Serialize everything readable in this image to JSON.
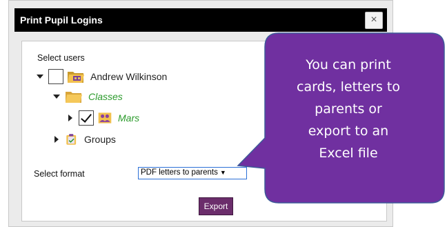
{
  "dialog": {
    "title": "Print Pupil Logins",
    "close_label": "×"
  },
  "form": {
    "select_users_label": "Select users",
    "tree": [
      {
        "label": "Andrew Wilkinson",
        "expanded": true,
        "checked": false,
        "icon": "staff-folder-icon"
      },
      {
        "label": "Classes",
        "expanded": true,
        "icon": "folder-icon",
        "color": "#2a9a2a"
      },
      {
        "label": "Mars",
        "expanded": false,
        "checked": true,
        "icon": "class-group-icon",
        "color": "#2a9a2a"
      },
      {
        "label": "Groups",
        "expanded": false,
        "icon": "clipboard-icon"
      }
    ],
    "select_format_label": "Select format",
    "format_value": "PDF letters to parents",
    "export_label": "Export"
  },
  "callout": {
    "lines": [
      "You can print",
      "cards, letters to",
      "parents or",
      "export to an",
      "Excel file"
    ],
    "color": "#7030a0"
  }
}
